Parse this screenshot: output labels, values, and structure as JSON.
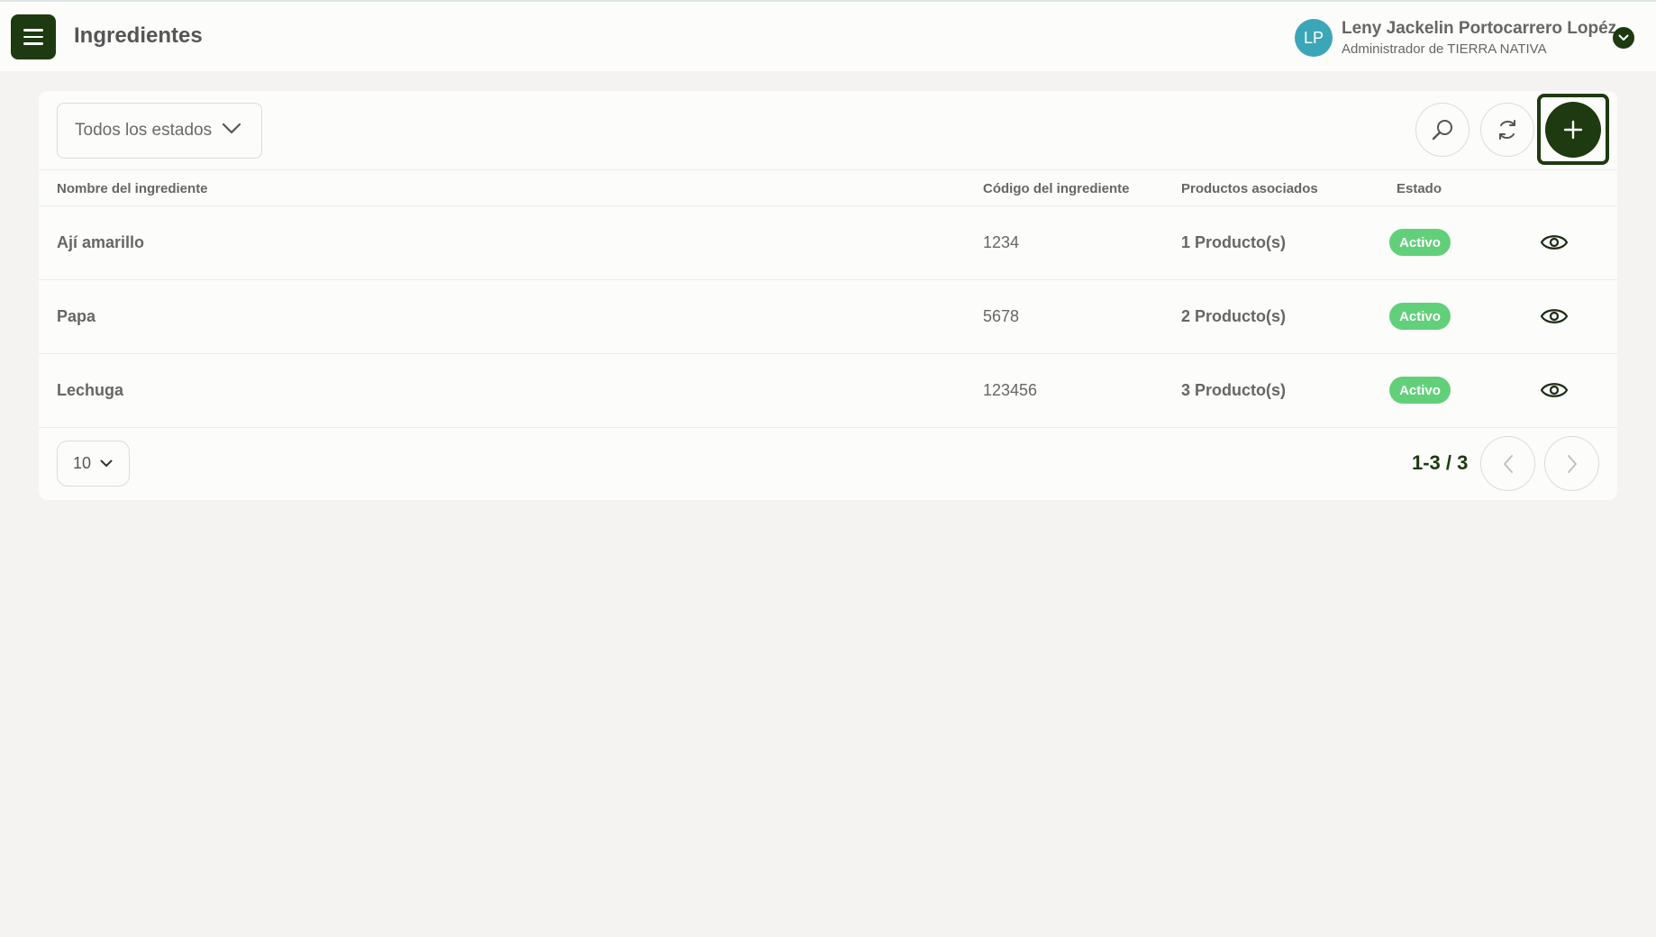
{
  "header": {
    "title": "Ingredientes",
    "user": {
      "initials": "LP",
      "name": "Leny Jackelin Portocarrero Lopéz",
      "role": "Administrador de TIERRA NATIVA"
    }
  },
  "toolbar": {
    "filter_value": "Todos los estados"
  },
  "table": {
    "columns": {
      "name": "Nombre del ingrediente",
      "code": "Código del ingrediente",
      "products": "Productos asociados",
      "status": "Estado"
    },
    "rows": [
      {
        "name": "Ají amarillo",
        "code": "1234",
        "products": "1 Producto(s)",
        "status": "Activo"
      },
      {
        "name": "Papa",
        "code": "5678",
        "products": "2 Producto(s)",
        "status": "Activo"
      },
      {
        "name": "Lechuga",
        "code": "123456",
        "products": "3 Producto(s)",
        "status": "Activo"
      }
    ]
  },
  "pagination": {
    "page_size": "10",
    "range": "1-3 / 3"
  },
  "colors": {
    "brand": "#1d3a10",
    "status_active": "#62d07a",
    "avatar": "#3ba6b7"
  }
}
